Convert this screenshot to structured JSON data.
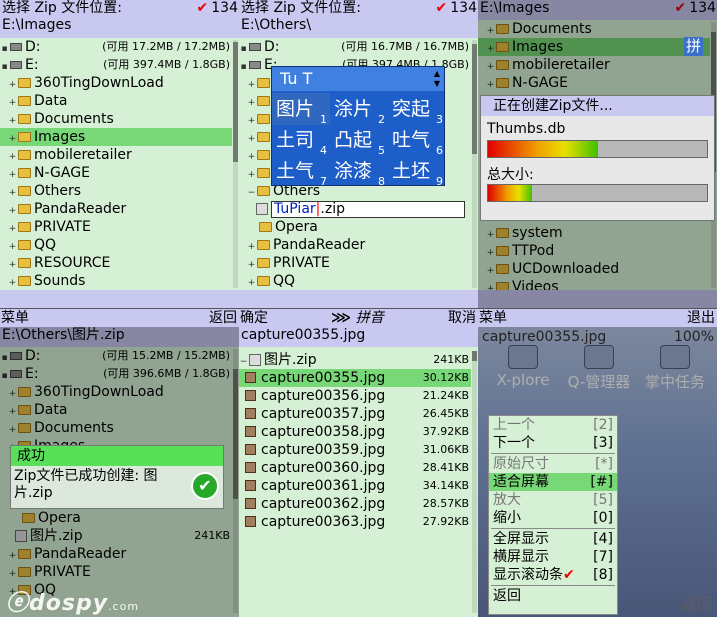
{
  "p1": {
    "title": "选择 Zip 文件位置:",
    "path": "E:\\Images",
    "count": "134",
    "drives": [
      {
        "label": "D:",
        "size": "(可用 17.2MB / 17.2MB)"
      },
      {
        "label": "E:",
        "size": "(可用 397.4MB / 1.8GB)"
      }
    ],
    "folders": [
      "360TingDownLoad",
      "Data",
      "Documents",
      "Images",
      "mobileretailer",
      "N-GAGE",
      "Others",
      "PandaReader",
      "PRIVATE",
      "QQ",
      "RESOURCE",
      "Sounds"
    ]
  },
  "p2": {
    "title": "选择 Zip 文件位置:",
    "path": "E:\\Others\\",
    "count": "134",
    "drives": [
      {
        "label": "D:",
        "size": "(可用 16.7MB / 16.7MB)"
      },
      {
        "label": "E:",
        "size": "(可用 397.4MB / 1.8GB)"
      }
    ],
    "hidden_initials": [
      "3",
      "D",
      "D",
      "I",
      "m",
      "N"
    ],
    "others": "Others",
    "filename": "TuPiar",
    "ext": ".zip",
    "after": [
      "Opera",
      "PandaReader",
      "PRIVATE",
      "QQ"
    ],
    "ime": {
      "header": "Tu T",
      "cands": [
        {
          "c": "图片",
          "n": "1"
        },
        {
          "c": "涂片",
          "n": "2"
        },
        {
          "c": "突起",
          "n": "3"
        },
        {
          "c": "土司",
          "n": "4"
        },
        {
          "c": "凸起",
          "n": "5"
        },
        {
          "c": "吐气",
          "n": "6"
        },
        {
          "c": "土气",
          "n": "7"
        },
        {
          "c": "涂漆",
          "n": "8"
        },
        {
          "c": "土坯",
          "n": "9"
        }
      ]
    }
  },
  "p3": {
    "path": "E:\\Images",
    "count": "134",
    "top_folders": [
      "Documents",
      "Images",
      "mobileretailer",
      "N-GAGE"
    ],
    "bottom_folders": [
      "system",
      "TTPod",
      "UCDownloaded",
      "Videos"
    ],
    "badge": "拼",
    "dialog": {
      "title": "正在创建Zip文件...",
      "file": "Thumbs.db",
      "total": "总大小:",
      "file_progress": 0.5,
      "total_progress": 0.2
    }
  },
  "p4": {
    "soft_left": "菜单",
    "soft_right": "返回",
    "path": "E:\\Others\\图片.zip",
    "drives": [
      {
        "label": "D:",
        "size": "(可用 15.2MB / 15.2MB)"
      },
      {
        "label": "E:",
        "size": "(可用 396.6MB / 1.8GB)"
      }
    ],
    "folders": [
      "360TingDownLoad",
      "Data",
      "Documents",
      "Images"
    ],
    "lower": [
      "Opera"
    ],
    "zip": {
      "name": "图片.zip",
      "size": "241KB"
    },
    "after": [
      "PandaReader",
      "PRIVATE",
      "QQ"
    ],
    "dialog": {
      "title": "成功",
      "msg": "Zip文件已成功创建: 图片.zip"
    },
    "watermark": "dospy",
    "watermark_suffix": ".com"
  },
  "p5": {
    "soft_left": "确定",
    "soft_mid": "拼音",
    "soft_right": "取消",
    "title": "capture00355.jpg",
    "zip": {
      "name": "图片.zip",
      "size": "241KB"
    },
    "files": [
      {
        "n": "capture00355.jpg",
        "s": "30.12KB"
      },
      {
        "n": "capture00356.jpg",
        "s": "21.24KB"
      },
      {
        "n": "capture00357.jpg",
        "s": "26.45KB"
      },
      {
        "n": "capture00358.jpg",
        "s": "37.92KB"
      },
      {
        "n": "capture00359.jpg",
        "s": "31.06KB"
      },
      {
        "n": "capture00360.jpg",
        "s": "28.41KB"
      },
      {
        "n": "capture00361.jpg",
        "s": "34.14KB"
      },
      {
        "n": "capture00362.jpg",
        "s": "28.57KB"
      },
      {
        "n": "capture00363.jpg",
        "s": "27.92KB"
      }
    ]
  },
  "p6": {
    "soft_left": "菜单",
    "soft_right": "退出",
    "title": "capture00355.jpg",
    "zoom": "100%",
    "apps": [
      "X-plore",
      "Q-管理器",
      "掌中任务"
    ],
    "back_hint": "返回",
    "menu": [
      {
        "l": "上一个",
        "k": "[2]",
        "d": true
      },
      {
        "l": "下一个",
        "k": "[3]",
        "d": false
      },
      {
        "sep": true
      },
      {
        "l": "原始尺寸",
        "k": "[*]",
        "d": true
      },
      {
        "l": "适合屏幕",
        "k": "[#]",
        "d": false,
        "sel": true
      },
      {
        "l": "放大",
        "k": "[5]",
        "d": true
      },
      {
        "l": "缩小",
        "k": "[0]",
        "d": false
      },
      {
        "sep": true
      },
      {
        "l": "全屏显示",
        "k": "[4]",
        "d": false
      },
      {
        "l": "横屏显示",
        "k": "[7]",
        "d": false
      },
      {
        "l": "显示滚动条",
        "k": "[8]",
        "d": false,
        "chk": true
      },
      {
        "sep": true
      },
      {
        "l": "返回",
        "k": "",
        "d": false
      }
    ]
  }
}
